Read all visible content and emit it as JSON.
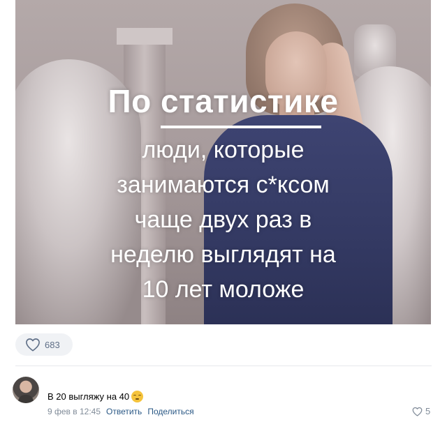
{
  "post": {
    "image": {
      "headline": "По статистике",
      "caption_lines": [
        "люди, которые",
        "занимаются с*ксом",
        "чаще двух раз в",
        "неделю выглядят на",
        "10 лет моложе"
      ]
    },
    "likes": {
      "icon": "heart-outline-icon",
      "count": "683"
    }
  },
  "comment": {
    "avatar": "avatar",
    "text": "В 20 выгляжу на 40",
    "emoji": "relieved-face-emoji",
    "date": "9 фев в 12:45",
    "reply_label": "Ответить",
    "share_label": "Поделиться",
    "likes": {
      "icon": "heart-outline-icon",
      "count": "5"
    }
  },
  "colors": {
    "link": "#2a5885",
    "meta": "#818c99",
    "like_count": "#5f6f87",
    "pill_bg": "#f0f2f5",
    "divider": "#e7e8ec"
  }
}
